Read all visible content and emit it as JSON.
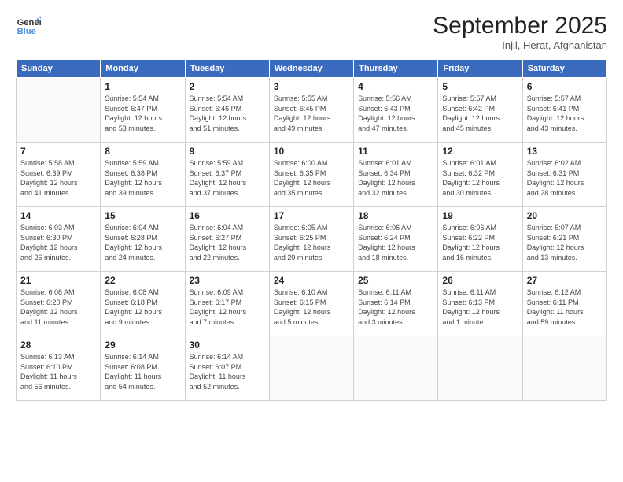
{
  "header": {
    "logo_line1": "General",
    "logo_line2": "Blue",
    "title": "September 2025",
    "subtitle": "Injil, Herat, Afghanistan"
  },
  "weekdays": [
    "Sunday",
    "Monday",
    "Tuesday",
    "Wednesday",
    "Thursday",
    "Friday",
    "Saturday"
  ],
  "weeks": [
    [
      {
        "day": "",
        "info": ""
      },
      {
        "day": "1",
        "info": "Sunrise: 5:54 AM\nSunset: 6:47 PM\nDaylight: 12 hours\nand 53 minutes."
      },
      {
        "day": "2",
        "info": "Sunrise: 5:54 AM\nSunset: 6:46 PM\nDaylight: 12 hours\nand 51 minutes."
      },
      {
        "day": "3",
        "info": "Sunrise: 5:55 AM\nSunset: 6:45 PM\nDaylight: 12 hours\nand 49 minutes."
      },
      {
        "day": "4",
        "info": "Sunrise: 5:56 AM\nSunset: 6:43 PM\nDaylight: 12 hours\nand 47 minutes."
      },
      {
        "day": "5",
        "info": "Sunrise: 5:57 AM\nSunset: 6:42 PM\nDaylight: 12 hours\nand 45 minutes."
      },
      {
        "day": "6",
        "info": "Sunrise: 5:57 AM\nSunset: 6:41 PM\nDaylight: 12 hours\nand 43 minutes."
      }
    ],
    [
      {
        "day": "7",
        "info": "Sunrise: 5:58 AM\nSunset: 6:39 PM\nDaylight: 12 hours\nand 41 minutes."
      },
      {
        "day": "8",
        "info": "Sunrise: 5:59 AM\nSunset: 6:38 PM\nDaylight: 12 hours\nand 39 minutes."
      },
      {
        "day": "9",
        "info": "Sunrise: 5:59 AM\nSunset: 6:37 PM\nDaylight: 12 hours\nand 37 minutes."
      },
      {
        "day": "10",
        "info": "Sunrise: 6:00 AM\nSunset: 6:35 PM\nDaylight: 12 hours\nand 35 minutes."
      },
      {
        "day": "11",
        "info": "Sunrise: 6:01 AM\nSunset: 6:34 PM\nDaylight: 12 hours\nand 32 minutes."
      },
      {
        "day": "12",
        "info": "Sunrise: 6:01 AM\nSunset: 6:32 PM\nDaylight: 12 hours\nand 30 minutes."
      },
      {
        "day": "13",
        "info": "Sunrise: 6:02 AM\nSunset: 6:31 PM\nDaylight: 12 hours\nand 28 minutes."
      }
    ],
    [
      {
        "day": "14",
        "info": "Sunrise: 6:03 AM\nSunset: 6:30 PM\nDaylight: 12 hours\nand 26 minutes."
      },
      {
        "day": "15",
        "info": "Sunrise: 6:04 AM\nSunset: 6:28 PM\nDaylight: 12 hours\nand 24 minutes."
      },
      {
        "day": "16",
        "info": "Sunrise: 6:04 AM\nSunset: 6:27 PM\nDaylight: 12 hours\nand 22 minutes."
      },
      {
        "day": "17",
        "info": "Sunrise: 6:05 AM\nSunset: 6:25 PM\nDaylight: 12 hours\nand 20 minutes."
      },
      {
        "day": "18",
        "info": "Sunrise: 6:06 AM\nSunset: 6:24 PM\nDaylight: 12 hours\nand 18 minutes."
      },
      {
        "day": "19",
        "info": "Sunrise: 6:06 AM\nSunset: 6:22 PM\nDaylight: 12 hours\nand 16 minutes."
      },
      {
        "day": "20",
        "info": "Sunrise: 6:07 AM\nSunset: 6:21 PM\nDaylight: 12 hours\nand 13 minutes."
      }
    ],
    [
      {
        "day": "21",
        "info": "Sunrise: 6:08 AM\nSunset: 6:20 PM\nDaylight: 12 hours\nand 11 minutes."
      },
      {
        "day": "22",
        "info": "Sunrise: 6:08 AM\nSunset: 6:18 PM\nDaylight: 12 hours\nand 9 minutes."
      },
      {
        "day": "23",
        "info": "Sunrise: 6:09 AM\nSunset: 6:17 PM\nDaylight: 12 hours\nand 7 minutes."
      },
      {
        "day": "24",
        "info": "Sunrise: 6:10 AM\nSunset: 6:15 PM\nDaylight: 12 hours\nand 5 minutes."
      },
      {
        "day": "25",
        "info": "Sunrise: 6:11 AM\nSunset: 6:14 PM\nDaylight: 12 hours\nand 3 minutes."
      },
      {
        "day": "26",
        "info": "Sunrise: 6:11 AM\nSunset: 6:13 PM\nDaylight: 12 hours\nand 1 minute."
      },
      {
        "day": "27",
        "info": "Sunrise: 6:12 AM\nSunset: 6:11 PM\nDaylight: 11 hours\nand 59 minutes."
      }
    ],
    [
      {
        "day": "28",
        "info": "Sunrise: 6:13 AM\nSunset: 6:10 PM\nDaylight: 11 hours\nand 56 minutes."
      },
      {
        "day": "29",
        "info": "Sunrise: 6:14 AM\nSunset: 6:08 PM\nDaylight: 11 hours\nand 54 minutes."
      },
      {
        "day": "30",
        "info": "Sunrise: 6:14 AM\nSunset: 6:07 PM\nDaylight: 11 hours\nand 52 minutes."
      },
      {
        "day": "",
        "info": ""
      },
      {
        "day": "",
        "info": ""
      },
      {
        "day": "",
        "info": ""
      },
      {
        "day": "",
        "info": ""
      }
    ]
  ]
}
